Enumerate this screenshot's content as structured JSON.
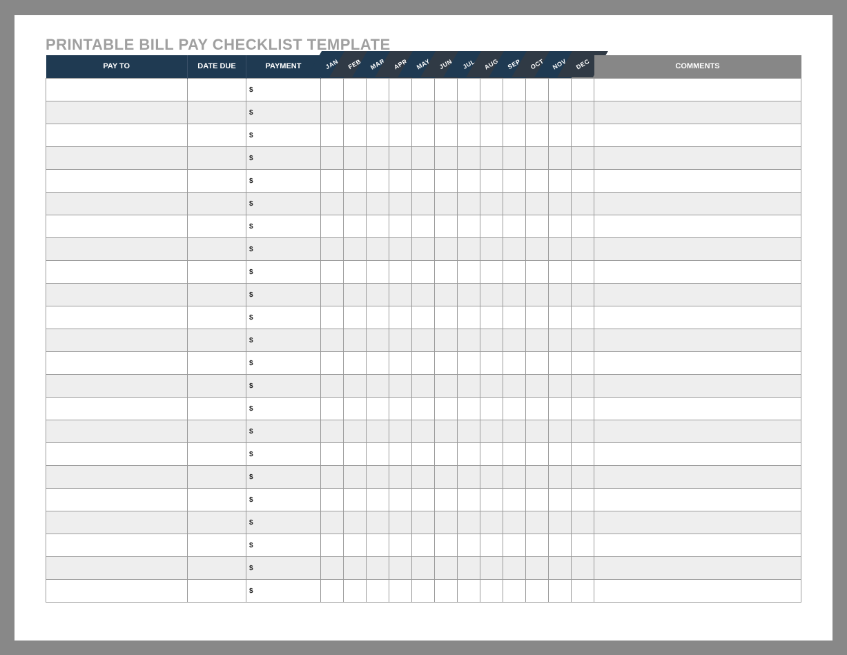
{
  "title": "PRINTABLE BILL PAY CHECKLIST TEMPLATE",
  "headers": {
    "pay_to": "PAY TO",
    "date_due": "DATE DUE",
    "payment": "PAYMENT",
    "comments": "COMMENTS"
  },
  "months": [
    "JAN",
    "FEB",
    "MAR",
    "APR",
    "MAY",
    "JUN",
    "JUL",
    "AUG",
    "SEP",
    "OCT",
    "NOV",
    "DEC"
  ],
  "currency_symbol": "$",
  "rows": [
    {
      "pay_to": "",
      "date_due": "",
      "payment": "",
      "comments": ""
    },
    {
      "pay_to": "",
      "date_due": "",
      "payment": "",
      "comments": ""
    },
    {
      "pay_to": "",
      "date_due": "",
      "payment": "",
      "comments": ""
    },
    {
      "pay_to": "",
      "date_due": "",
      "payment": "",
      "comments": ""
    },
    {
      "pay_to": "",
      "date_due": "",
      "payment": "",
      "comments": ""
    },
    {
      "pay_to": "",
      "date_due": "",
      "payment": "",
      "comments": ""
    },
    {
      "pay_to": "",
      "date_due": "",
      "payment": "",
      "comments": ""
    },
    {
      "pay_to": "",
      "date_due": "",
      "payment": "",
      "comments": ""
    },
    {
      "pay_to": "",
      "date_due": "",
      "payment": "",
      "comments": ""
    },
    {
      "pay_to": "",
      "date_due": "",
      "payment": "",
      "comments": ""
    },
    {
      "pay_to": "",
      "date_due": "",
      "payment": "",
      "comments": ""
    },
    {
      "pay_to": "",
      "date_due": "",
      "payment": "",
      "comments": ""
    },
    {
      "pay_to": "",
      "date_due": "",
      "payment": "",
      "comments": ""
    },
    {
      "pay_to": "",
      "date_due": "",
      "payment": "",
      "comments": ""
    },
    {
      "pay_to": "",
      "date_due": "",
      "payment": "",
      "comments": ""
    },
    {
      "pay_to": "",
      "date_due": "",
      "payment": "",
      "comments": ""
    },
    {
      "pay_to": "",
      "date_due": "",
      "payment": "",
      "comments": ""
    },
    {
      "pay_to": "",
      "date_due": "",
      "payment": "",
      "comments": ""
    },
    {
      "pay_to": "",
      "date_due": "",
      "payment": "",
      "comments": ""
    },
    {
      "pay_to": "",
      "date_due": "",
      "payment": "",
      "comments": ""
    },
    {
      "pay_to": "",
      "date_due": "",
      "payment": "",
      "comments": ""
    },
    {
      "pay_to": "",
      "date_due": "",
      "payment": "",
      "comments": ""
    },
    {
      "pay_to": "",
      "date_due": "",
      "payment": "",
      "comments": ""
    }
  ]
}
